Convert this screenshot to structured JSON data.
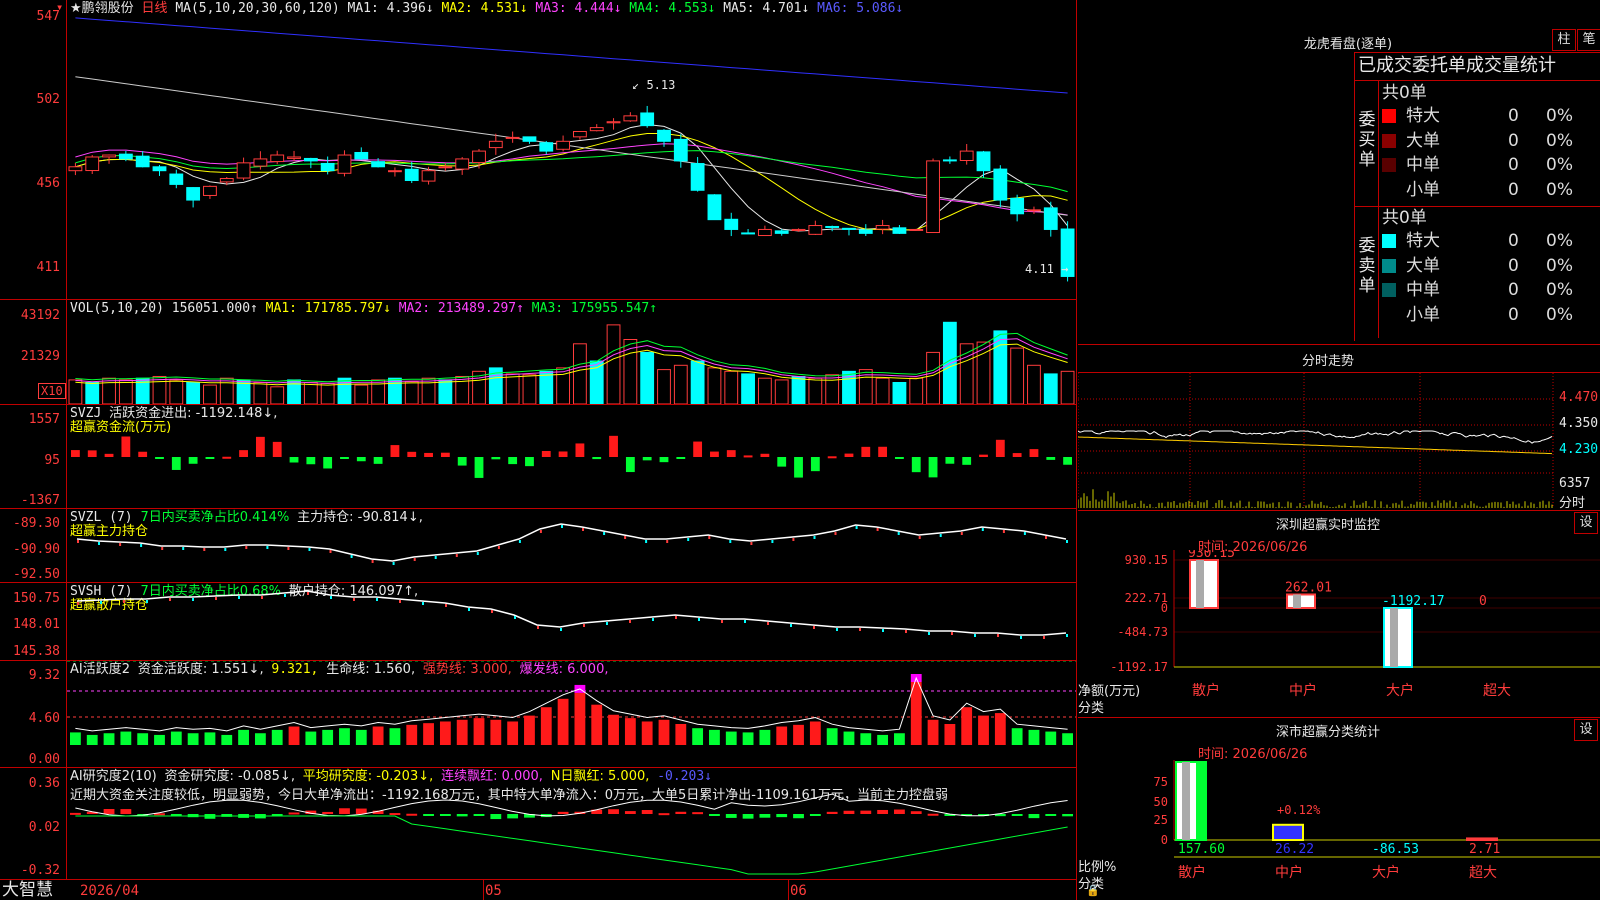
{
  "stock_name": "★鹏翎股份",
  "period": "日线",
  "ma_header": {
    "def": "MA(5,10,20,30,60,120)",
    "items": [
      {
        "text": "MA1: 4.396↓",
        "color": "#e8e8e8"
      },
      {
        "text": "MA2: 4.531↓",
        "color": "#ffff00"
      },
      {
        "text": "MA3: 4.444↓",
        "color": "#ff44ff"
      },
      {
        "text": "MA4: 4.553↓",
        "color": "#00ff33"
      },
      {
        "text": "MA5: 4.701↓",
        "color": "#e8e8e8"
      },
      {
        "text": "MA6: 5.086↓",
        "color": "#5a5aff"
      }
    ]
  },
  "price_axis": [
    "547",
    "502",
    "456",
    "411"
  ],
  "price_annotations": {
    "high": "5.13",
    "low": "4.11"
  },
  "vol_header": {
    "def": "VOL(5,10,20)",
    "vol": "156051.000↑",
    "ma1": "MA1: 171785.797↓",
    "ma2": "MA2: 213489.297↑",
    "ma3": "MA3: 175955.547↑"
  },
  "vol_axis": [
    "43192",
    "21329"
  ],
  "vol_unit": "X10",
  "svzj": {
    "title": "SVZJ",
    "line1": "活跃资金进出: -1192.148↓,",
    "line2": "超赢资金流(万元)",
    "axis": [
      "1557",
      "95",
      "-1367"
    ]
  },
  "svzl": {
    "title": "SVZL (7)",
    "pct": "7日内买卖净占比0.414%",
    "hold": "主力持仓: -90.814↓,",
    "line2": "超赢主力持仓",
    "axis": [
      "-89.30",
      "-90.90",
      "-92.50"
    ]
  },
  "svsh": {
    "title": "SVSH (7)",
    "pct": "7日内买卖净占比0.68%",
    "hold": "散户持仓: 146.097↑,",
    "line2": "超赢散户持仓",
    "axis": [
      "150.75",
      "148.01",
      "145.38"
    ]
  },
  "ai_active": {
    "title": "AI活跃度2",
    "a": "资金活跃度: 1.551↓,",
    "b": "9.321,",
    "c": "生命线: 1.560,",
    "d": "强势线: 3.000,",
    "e": "爆发线: 6.000,",
    "axis": [
      "9.32",
      "4.60",
      "0.00"
    ]
  },
  "ai_research": {
    "title": "AI研究度2(10)",
    "a": "资金研究度: -0.085↓,",
    "b": "平均研究度: -0.203↓,",
    "c": "连续飘红: 0.000,",
    "d": "N日飘红: 5.000,",
    "e": "-0.203↓",
    "summary": "近期大资金关注度较低，明显弱势，今日大单净流出：-1192.168万元，其中特大单净流入：0万元，大单5日累计净出-1109.161万元，当前主力控盘弱",
    "axis": [
      "0.36",
      "0.02",
      "-0.32"
    ]
  },
  "bottom": {
    "brand": "大智慧",
    "date1": "2026/04",
    "date2": "05",
    "date3": "06"
  },
  "lhb": {
    "title": "龙虎看盘(逐单)",
    "btn1": "柱",
    "btn2": "笔",
    "header": "已成交委托单成交量统计",
    "buy_label": "委买单",
    "sell_label": "委卖单",
    "buy_total": "共0单",
    "sell_total": "共0单",
    "buy_rows": [
      {
        "name": "特大",
        "v": "0",
        "p": "0%",
        "color": "#ff0000"
      },
      {
        "name": "大单",
        "v": "0",
        "p": "0%",
        "color": "#8b0000"
      },
      {
        "name": "中单",
        "v": "0",
        "p": "0%",
        "color": "#5a0000"
      },
      {
        "name": "小单",
        "v": "0",
        "p": "0%",
        "color": "#000000"
      }
    ],
    "sell_rows": [
      {
        "name": "特大",
        "v": "0",
        "p": "0%",
        "color": "#00ffff"
      },
      {
        "name": "大单",
        "v": "0",
        "p": "0%",
        "color": "#008b8b"
      },
      {
        "name": "中单",
        "v": "0",
        "p": "0%",
        "color": "#006060"
      },
      {
        "name": "小单",
        "v": "0",
        "p": "0%",
        "color": "#000000"
      }
    ]
  },
  "fenshi": {
    "title": "分时走势",
    "axis": [
      "4.470",
      "4.350",
      "4.230"
    ],
    "vol": "6357",
    "vol_label": "分时"
  },
  "monitor": {
    "title": "深圳超赢实时监控",
    "btn": "设",
    "time": "时间: 2026/06/26",
    "axis": [
      "930.15",
      "222.71",
      "0",
      "-484.73",
      "-1192.17"
    ],
    "ylabel1": "净额(万元)",
    "ylabel2": "分类",
    "bars": [
      {
        "cat": "散户",
        "value": 930.15,
        "label": "930.15"
      },
      {
        "cat": "中户",
        "value": 262.01,
        "label": "262.01"
      },
      {
        "cat": "大户",
        "value": -1192.17,
        "label": "-1192.17"
      },
      {
        "cat": "超大",
        "value": 0,
        "label": "0"
      }
    ]
  },
  "classify": {
    "title": "深市超赢分类统计",
    "btn": "设",
    "time": "时间: 2026/06/26",
    "axis": [
      "75",
      "50",
      "25",
      "0"
    ],
    "ylabel1": "比例%",
    "ylabel2": "分类",
    "pct_label": "+0.12%",
    "bars": [
      {
        "cat": "散户",
        "value": 157.6,
        "label": "157.60"
      },
      {
        "cat": "中户",
        "value": 26.22,
        "label": "26.22"
      },
      {
        "cat": "大户",
        "value": -86.53,
        "label": "-86.53"
      },
      {
        "cat": "超大",
        "value": 2.71,
        "label": "2.71"
      }
    ]
  }
}
